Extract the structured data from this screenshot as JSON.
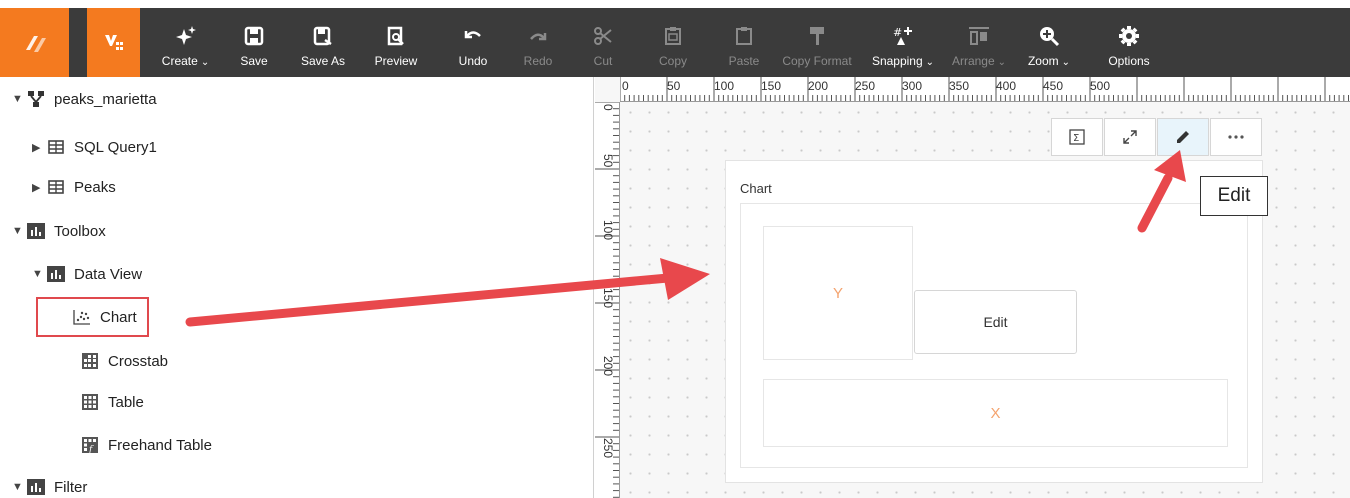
{
  "toolbar": {
    "buttons": [
      {
        "label": "Create",
        "icon": "sparkle-icon",
        "caret": "⌄"
      },
      {
        "label": "Save",
        "icon": "save-icon"
      },
      {
        "label": "Save As",
        "icon": "save-as-icon"
      },
      {
        "label": "Preview",
        "icon": "preview-icon"
      },
      {
        "label": "Undo",
        "icon": "undo-icon"
      },
      {
        "label": "Redo",
        "icon": "redo-icon"
      },
      {
        "label": "Cut",
        "icon": "cut-icon"
      },
      {
        "label": "Copy",
        "icon": "copy-icon"
      },
      {
        "label": "Paste",
        "icon": "paste-icon"
      },
      {
        "label": "Copy Format",
        "icon": "paint-roller-icon"
      },
      {
        "label": "Snapping",
        "icon": "snapping-icon",
        "caret": "⌄"
      },
      {
        "label": "Arrange",
        "icon": "arrange-icon",
        "caret": "⌄"
      },
      {
        "label": "Zoom",
        "icon": "zoom-icon",
        "caret": "⌄"
      },
      {
        "label": "Options",
        "icon": "gear-icon"
      }
    ],
    "accent": "#f47a1f",
    "background": "#3b3b3b"
  },
  "tree": {
    "datasource": "peaks_marietta",
    "tables": [
      "SQL Query1",
      "Peaks"
    ],
    "toolbox": "Toolbox",
    "data_view": "Data View",
    "items": [
      "Chart",
      "Crosstab",
      "Table",
      "Freehand Table"
    ],
    "filter": "Filter"
  },
  "ruler": {
    "top": [
      "0",
      "50",
      "100",
      "150",
      "200",
      "250",
      "300",
      "350",
      "400",
      "450",
      "500"
    ],
    "left": [
      "0",
      "50",
      "100",
      "150",
      "200",
      "250"
    ]
  },
  "widget": {
    "title": "Chart",
    "y_zone": "Y",
    "x_zone": "X",
    "edit_label": "Edit",
    "tooltip": "Edit"
  },
  "colors": {
    "highlight": "#e0494d",
    "zone_text": "#f4a36e"
  }
}
